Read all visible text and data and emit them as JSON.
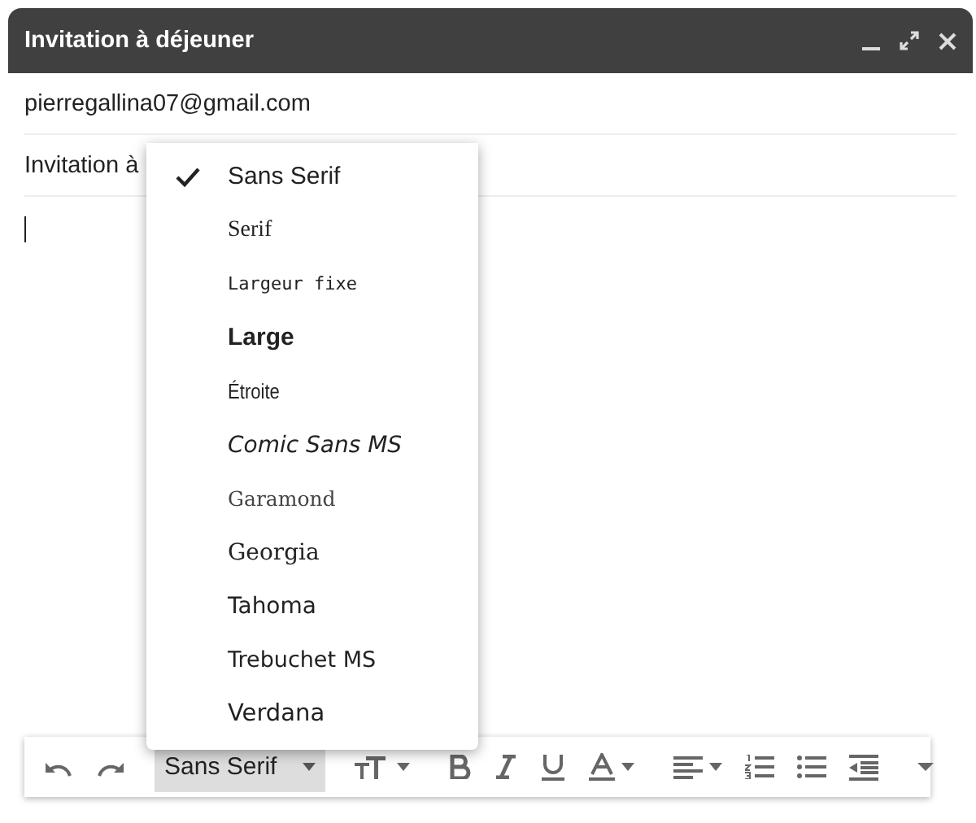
{
  "window": {
    "title": "Invitation à déjeuner"
  },
  "to": {
    "value": "pierregallina07@gmail.com"
  },
  "subject": {
    "value": "Invitation à"
  },
  "toolbar": {
    "font": {
      "label": "Sans Serif",
      "open": true
    }
  },
  "font_menu": {
    "items": [
      {
        "label": "Sans Serif",
        "kind": "sans",
        "selected": true
      },
      {
        "label": "Serif",
        "kind": "serif",
        "selected": false
      },
      {
        "label": "Largeur fixe",
        "kind": "mono",
        "selected": false
      },
      {
        "label": "Large",
        "kind": "wide",
        "selected": false
      },
      {
        "label": "Étroite",
        "kind": "narrow",
        "selected": false
      },
      {
        "label": "Comic Sans MS",
        "kind": "comic",
        "selected": false
      },
      {
        "label": "Garamond",
        "kind": "garamond",
        "selected": false
      },
      {
        "label": "Georgia",
        "kind": "georgia",
        "selected": false
      },
      {
        "label": "Tahoma",
        "kind": "tahoma",
        "selected": false
      },
      {
        "label": "Trebuchet MS",
        "kind": "trebuchet",
        "selected": false
      },
      {
        "label": "Verdana",
        "kind": "verdana",
        "selected": false
      }
    ]
  }
}
